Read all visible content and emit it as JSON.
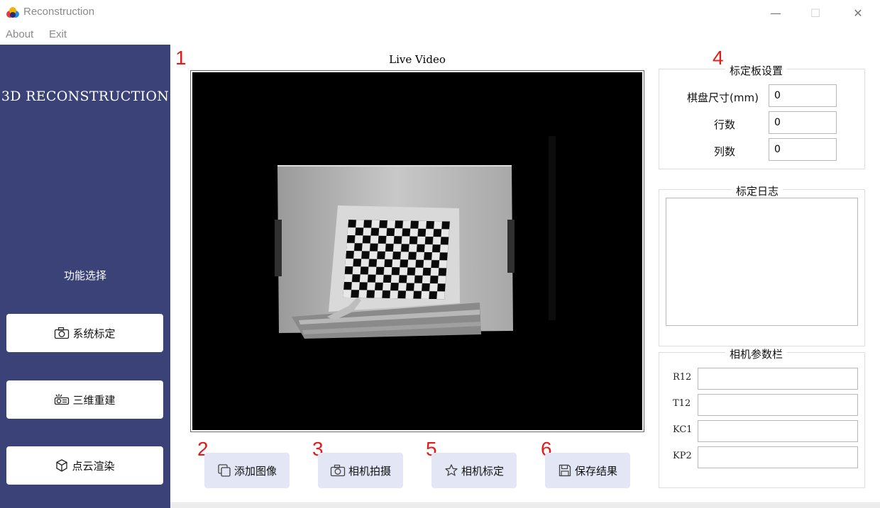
{
  "window": {
    "title": "Reconstruction",
    "minimize": "—",
    "maximize": "☐",
    "close": "✕"
  },
  "menu": [
    "About",
    "Exit"
  ],
  "sidebar": {
    "brand": "3D RECONSTRUCTION",
    "section": "功能选择",
    "buttons": [
      "系统标定",
      "三维重建",
      "点云渲染"
    ]
  },
  "video": {
    "title": "Live Video"
  },
  "actions": [
    "添加图像",
    "相机拍摄",
    "相机标定",
    "保存结果"
  ],
  "markers": [
    "1",
    "2",
    "3",
    "4",
    "5",
    "6"
  ],
  "board_settings": {
    "title": "标定板设置",
    "fields": [
      {
        "label": "棋盘尺寸(mm)",
        "value": "0"
      },
      {
        "label": "行数",
        "value": "0"
      },
      {
        "label": "列数",
        "value": "0"
      }
    ]
  },
  "log": {
    "title": "标定日志",
    "content": ""
  },
  "camera_params": {
    "title": "相机参数栏",
    "fields": [
      {
        "label": "R12",
        "value": ""
      },
      {
        "label": "T12",
        "value": ""
      },
      {
        "label": "KC1",
        "value": ""
      },
      {
        "label": "KP2",
        "value": ""
      }
    ]
  },
  "colors": {
    "sidebar": "#3a4278",
    "action_button": "#e3e6f5",
    "marker": "#e21b1b"
  }
}
